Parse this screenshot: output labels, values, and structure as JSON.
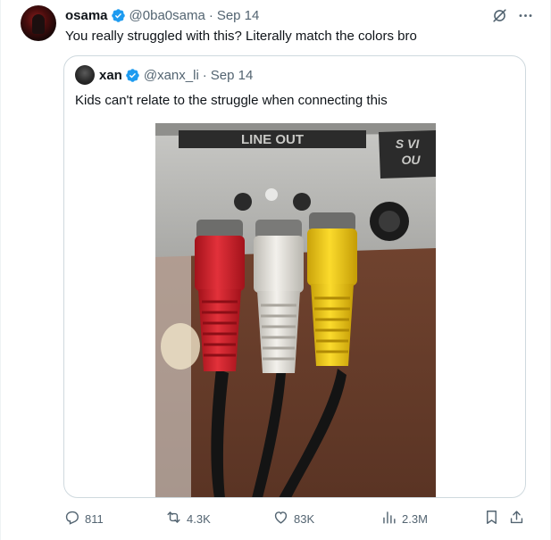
{
  "tweet": {
    "author_name": "osama",
    "author_handle": "@0ba0sama",
    "separator": "·",
    "date": "Sep 14",
    "text": "You really struggled with this? Literally match the colors bro"
  },
  "quote": {
    "author_name": "xan",
    "author_handle": "@xanx_li",
    "separator": "·",
    "date": "Sep 14",
    "text": "Kids can't relate to the struggle when connecting this",
    "photo_labels": {
      "line_out": "LINE OUT",
      "s_video_1": "S VI",
      "s_video_2": "OU"
    }
  },
  "actions": {
    "replies": "811",
    "reposts": "4.3K",
    "likes": "83K",
    "views": "2.3M"
  },
  "icons": {
    "verified": "verified-badge-icon",
    "grok": "grok-icon",
    "more": "more-icon",
    "reply": "reply-icon",
    "repost": "repost-icon",
    "like": "heart-icon",
    "views": "views-icon",
    "bookmark": "bookmark-icon",
    "share": "share-icon"
  },
  "colors": {
    "verified": "#1d9bf0",
    "text_secondary": "#536471",
    "border": "#cfd9de",
    "plug_red": "#d11f2a",
    "plug_white": "#e8e6e1",
    "plug_yellow": "#f2cc17"
  }
}
